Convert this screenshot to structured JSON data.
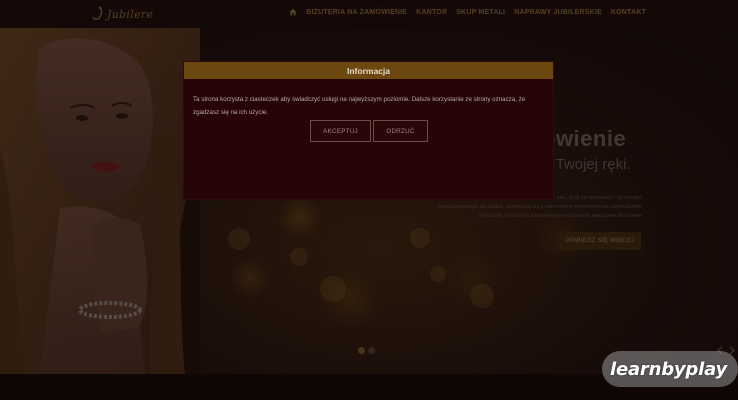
{
  "header": {
    "logo_text": "Jubilere",
    "nav": [
      {
        "label": "BIŻUTERIA NA ZAMÓWIENIE"
      },
      {
        "label": "KANTOR"
      },
      {
        "label": "SKUP METALI"
      },
      {
        "label": "NAPRAWY JUBILERSKIE"
      },
      {
        "label": "KONTAKT"
      }
    ]
  },
  "hero": {
    "title": "ówienie",
    "subtitle": "ju Twojej ręki.",
    "description": "Biżuteria na zamówienie stworzona przez nas. Jeśli nie znalazłeś / eś czegoś przygotowanego dla siebie, skontaktuj się z nami celem umówienia na indywidualne spotkanie, na którym zaprojektujemy biżuterię specjalnie dla Ciebie",
    "button": "DOWIEDZ SIĘ WIĘCEJ",
    "slides_total": 2,
    "slide_active": 1
  },
  "modal": {
    "title": "Informacja",
    "body": "Ta strona korzysta z ciasteczek aby świadczyć usługi na najwyższym poziomie. Dalsze korzystanie ze strony oznacza, że zgadzasz się na ich użycie.",
    "accept": "AKCEPTUJ",
    "reject": "ODRZUĆ"
  },
  "watermark": "learnbyplay",
  "colors": {
    "brand_gold": "#8a6e3e",
    "modal_header": "#6c4710",
    "modal_bg": "#260407"
  }
}
